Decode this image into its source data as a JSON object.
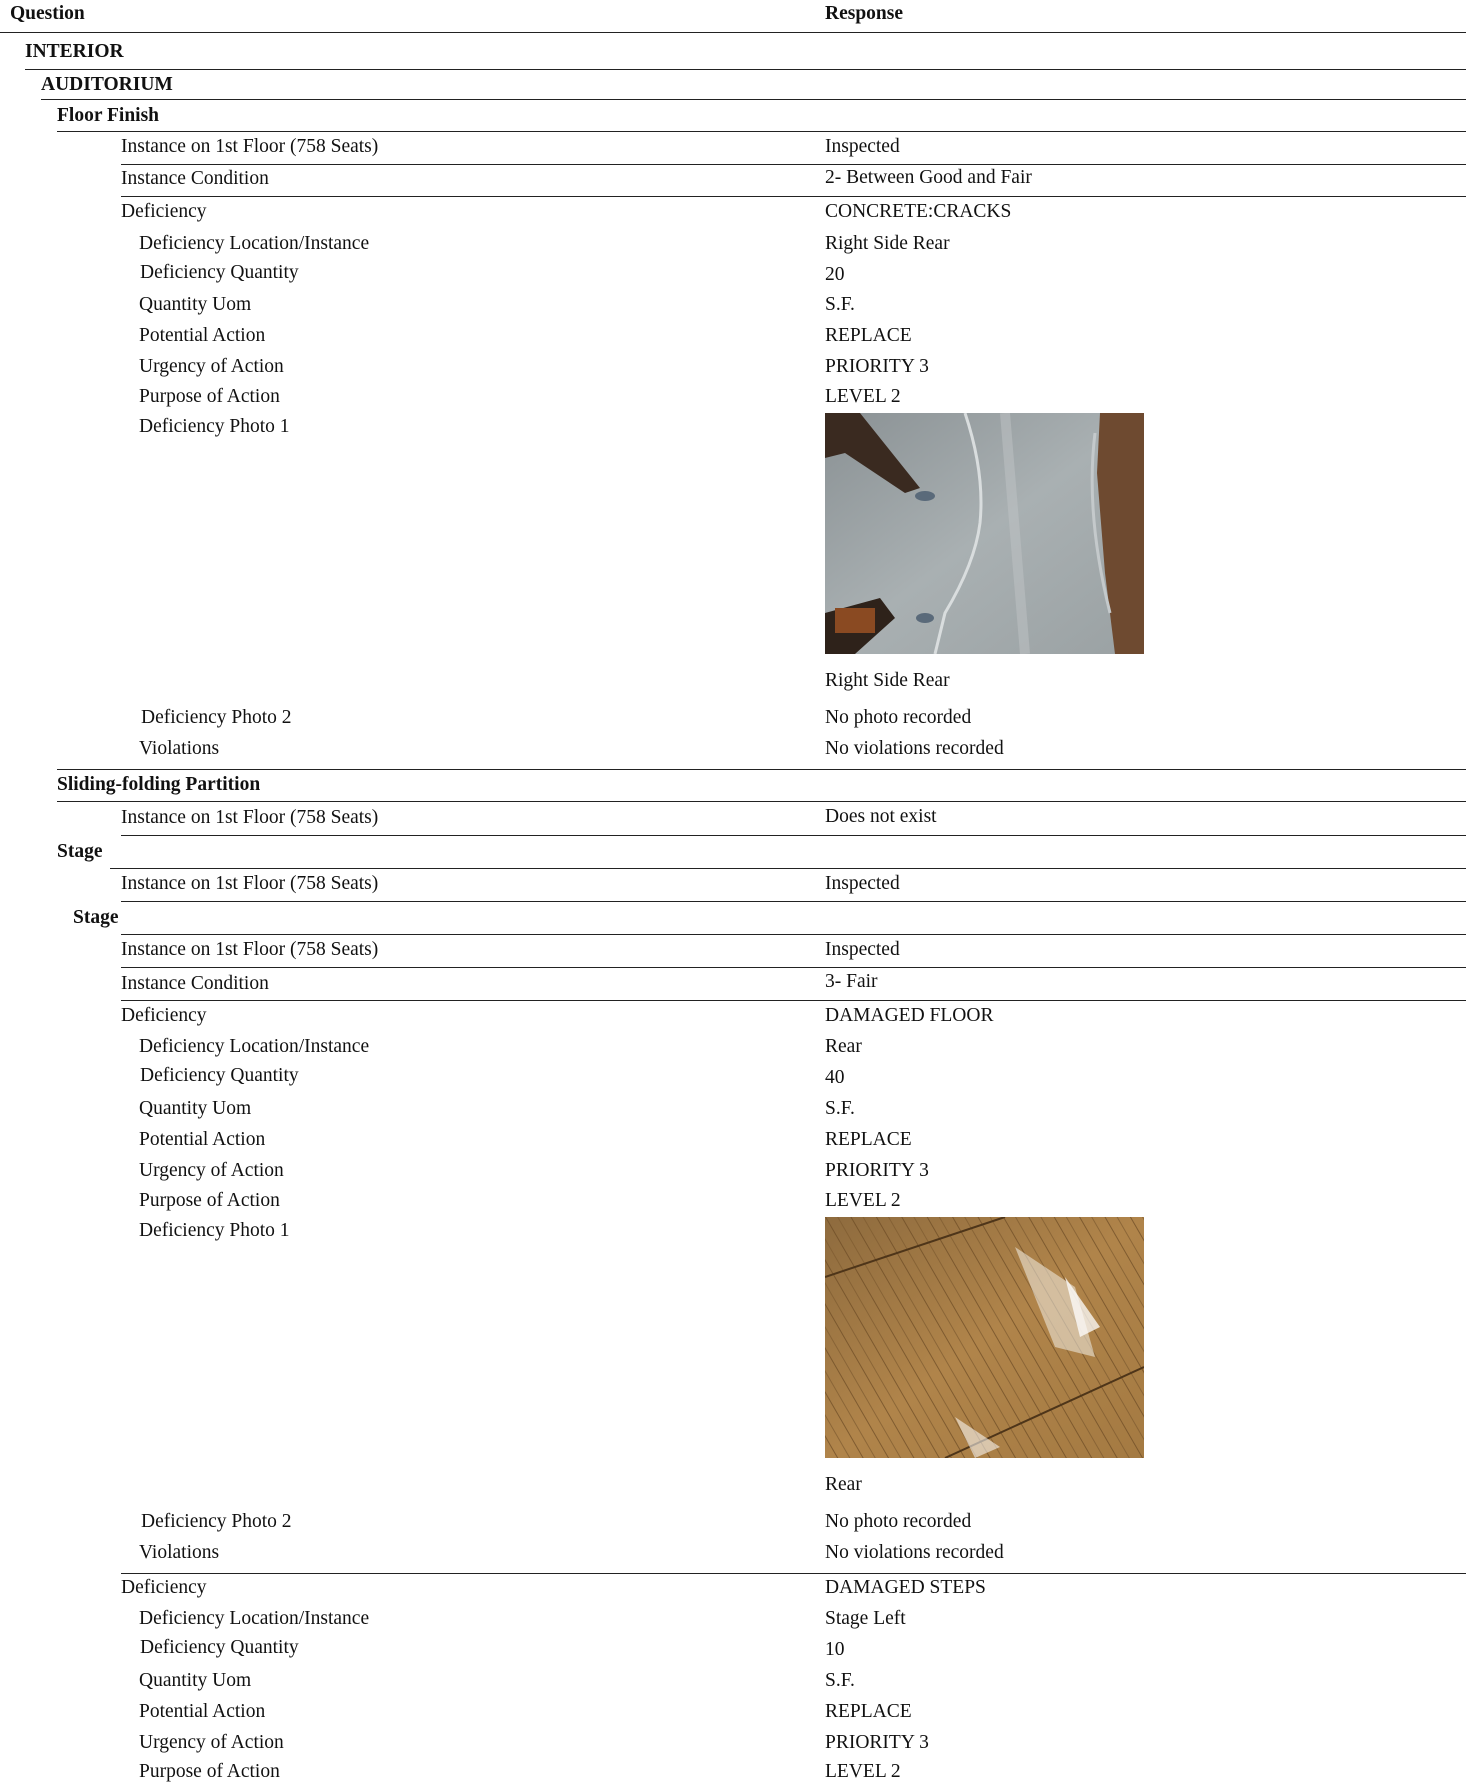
{
  "header": {
    "question": "Question",
    "response": "Response"
  },
  "sections": {
    "interior": "INTERIOR",
    "auditorium": "AUDITORIUM",
    "floor_finish": "Floor Finish",
    "sliding_partition": "Sliding-folding Partition",
    "stage_group": "Stage",
    "stage_item": "Stage"
  },
  "floor_finish": {
    "instance_q": "Instance on 1st Floor (758 Seats)",
    "instance_r": "Inspected",
    "condition_q": "Instance Condition",
    "condition_r": "2- Between Good and Fair",
    "deficiency_q": "Deficiency",
    "deficiency_r": "CONCRETE:CRACKS",
    "location_q": "Deficiency Location/Instance",
    "location_r": "Right Side Rear",
    "quantity_q": "Deficiency Quantity",
    "quantity_r": "20",
    "uom_q": "Quantity Uom",
    "uom_r": "S.F.",
    "action_q": "Potential Action",
    "action_r": "REPLACE",
    "urgency_q": "Urgency of Action",
    "urgency_r": "PRIORITY 3",
    "purpose_q": "Purpose of Action",
    "purpose_r": "LEVEL 2",
    "photo1_q": "Deficiency Photo 1",
    "photo1_caption": "Right Side Rear",
    "photo2_q": "Deficiency Photo 2",
    "photo2_r": "No photo recorded",
    "violations_q": "Violations",
    "violations_r": "No violations recorded"
  },
  "sliding_partition": {
    "instance_q": "Instance on 1st Floor (758 Seats)",
    "instance_r": "Does not exist"
  },
  "stage_group": {
    "instance_q": "Instance on 1st Floor (758 Seats)",
    "instance_r": "Inspected"
  },
  "stage": {
    "instance_q": "Instance on 1st Floor (758 Seats)",
    "instance_r": "Inspected",
    "condition_q": "Instance Condition",
    "condition_r": "3- Fair",
    "def1": {
      "deficiency_q": "Deficiency",
      "deficiency_r": "DAMAGED FLOOR",
      "location_q": "Deficiency Location/Instance",
      "location_r": "Rear",
      "quantity_q": "Deficiency Quantity",
      "quantity_r": "40",
      "uom_q": "Quantity Uom",
      "uom_r": "S.F.",
      "action_q": "Potential Action",
      "action_r": "REPLACE",
      "urgency_q": "Urgency of Action",
      "urgency_r": "PRIORITY 3",
      "purpose_q": "Purpose of Action",
      "purpose_r": "LEVEL 2",
      "photo1_q": "Deficiency Photo 1",
      "photo1_caption": "Rear",
      "photo2_q": "Deficiency Photo 2",
      "photo2_r": "No photo recorded",
      "violations_q": "Violations",
      "violations_r": "No violations recorded"
    },
    "def2": {
      "deficiency_q": "Deficiency",
      "deficiency_r": "DAMAGED STEPS",
      "location_q": "Deficiency Location/Instance",
      "location_r": "Stage Left",
      "quantity_q": "Deficiency Quantity",
      "quantity_r": "10",
      "uom_q": "Quantity Uom",
      "uom_r": "S.F.",
      "action_q": "Potential Action",
      "action_r": "REPLACE",
      "urgency_q": "Urgency of Action",
      "urgency_r": "PRIORITY 3",
      "purpose_q": "Purpose of Action",
      "purpose_r": "LEVEL 2"
    }
  }
}
